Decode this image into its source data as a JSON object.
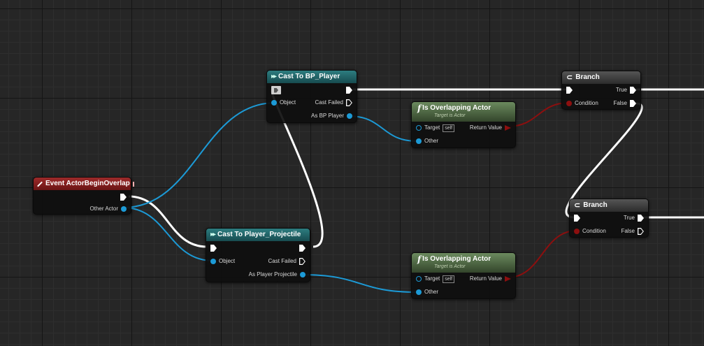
{
  "nodes": {
    "event": {
      "title": "Event ActorBeginOverlap",
      "other_actor": "Other Actor"
    },
    "cast_bp": {
      "title": "Cast To BP_Player",
      "object": "Object",
      "cast_failed": "Cast Failed",
      "as_out": "As BP Player"
    },
    "cast_proj": {
      "title": "Cast To Player_Projectile",
      "object": "Object",
      "cast_failed": "Cast Failed",
      "as_out": "As Player Projectile"
    },
    "overlap1": {
      "title": "Is Overlapping Actor",
      "subtitle": "Target is Actor",
      "target": "Target",
      "self": "self",
      "other": "Other",
      "return_value": "Return Value"
    },
    "overlap2": {
      "title": "Is Overlapping Actor",
      "subtitle": "Target is Actor",
      "target": "Target",
      "self": "self",
      "other": "Other",
      "return_value": "Return Value"
    },
    "branch1": {
      "title": "Branch",
      "true_label": "True",
      "condition": "Condition",
      "false_label": "False"
    },
    "branch2": {
      "title": "Branch",
      "true_label": "True",
      "condition": "Condition",
      "false_label": "False"
    }
  },
  "colors": {
    "exec_wire": "#ffffff",
    "object_wire": "#1c9ad6",
    "bool_wire": "#8c0f0f",
    "event_header": "#8a1f1f",
    "cast_header": "#236468",
    "function_header": "#4f6a44",
    "branch_header": "#3f3f3f"
  },
  "icons": {
    "event": "event-diamond-icon",
    "cast": "cast-arrows-icon",
    "function": "function-f-icon",
    "branch": "branch-icon"
  }
}
